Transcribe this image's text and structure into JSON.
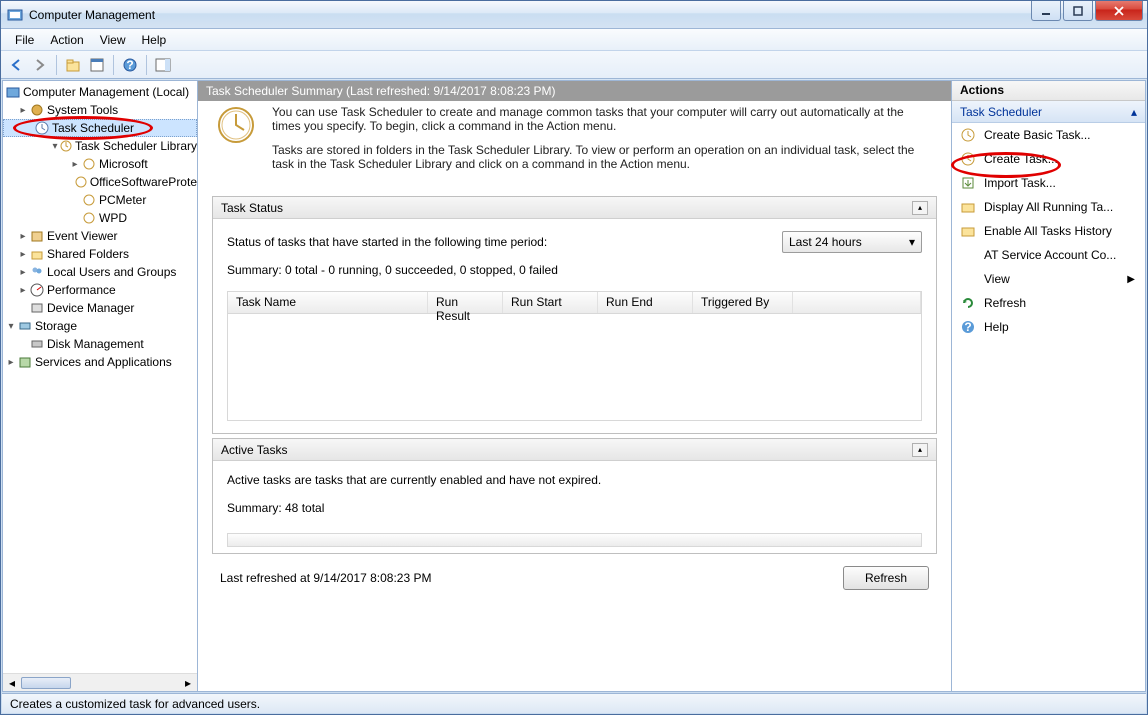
{
  "window": {
    "title": "Computer Management"
  },
  "menus": {
    "file": "File",
    "action": "Action",
    "view": "View",
    "help": "Help"
  },
  "tree": {
    "root": "Computer Management (Local)",
    "system_tools": "System Tools",
    "task_scheduler": "Task Scheduler",
    "ts_library": "Task Scheduler Library",
    "microsoft": "Microsoft",
    "office": "OfficeSoftwareProte",
    "pcmeter": "PCMeter",
    "wpd": "WPD",
    "event_viewer": "Event Viewer",
    "shared_folders": "Shared Folders",
    "local_users": "Local Users and Groups",
    "performance": "Performance",
    "device_manager": "Device Manager",
    "storage": "Storage",
    "disk_management": "Disk Management",
    "services_apps": "Services and Applications"
  },
  "center": {
    "header": "Task Scheduler Summary (Last refreshed: 9/14/2017 8:08:23 PM)",
    "intro1": "You can use Task Scheduler to create and manage common tasks that your computer will carry out automatically at the times you specify. To begin, click a command in the Action menu.",
    "intro2": "Tasks are stored in folders in the Task Scheduler Library. To view or perform an operation on an individual task, select the task in the Task Scheduler Library and click on a command in the Action menu.",
    "task_status_title": "Task Status",
    "status_label": "Status of tasks that have started in the following time period:",
    "period_option": "Last 24 hours",
    "summary_line": "Summary: 0 total - 0 running, 0 succeeded, 0 stopped, 0 failed",
    "cols": {
      "name": "Task Name",
      "result": "Run Result",
      "start": "Run Start",
      "end": "Run End",
      "trig": "Triggered By"
    },
    "active_title": "Active Tasks",
    "active_desc": "Active tasks are tasks that are currently enabled and have not expired.",
    "active_summary": "Summary: 48 total",
    "last_refreshed": "Last refreshed at 9/14/2017 8:08:23 PM",
    "refresh_btn": "Refresh"
  },
  "actions": {
    "header": "Actions",
    "group": "Task Scheduler",
    "items": {
      "create_basic": "Create Basic Task...",
      "create_task": "Create Task...",
      "import_task": "Import Task...",
      "display_running": "Display All Running Ta...",
      "enable_history": "Enable All Tasks History",
      "at_service": "AT Service Account Co...",
      "view": "View",
      "refresh": "Refresh",
      "help": "Help"
    }
  },
  "statusbar": "Creates a customized task for advanced users."
}
